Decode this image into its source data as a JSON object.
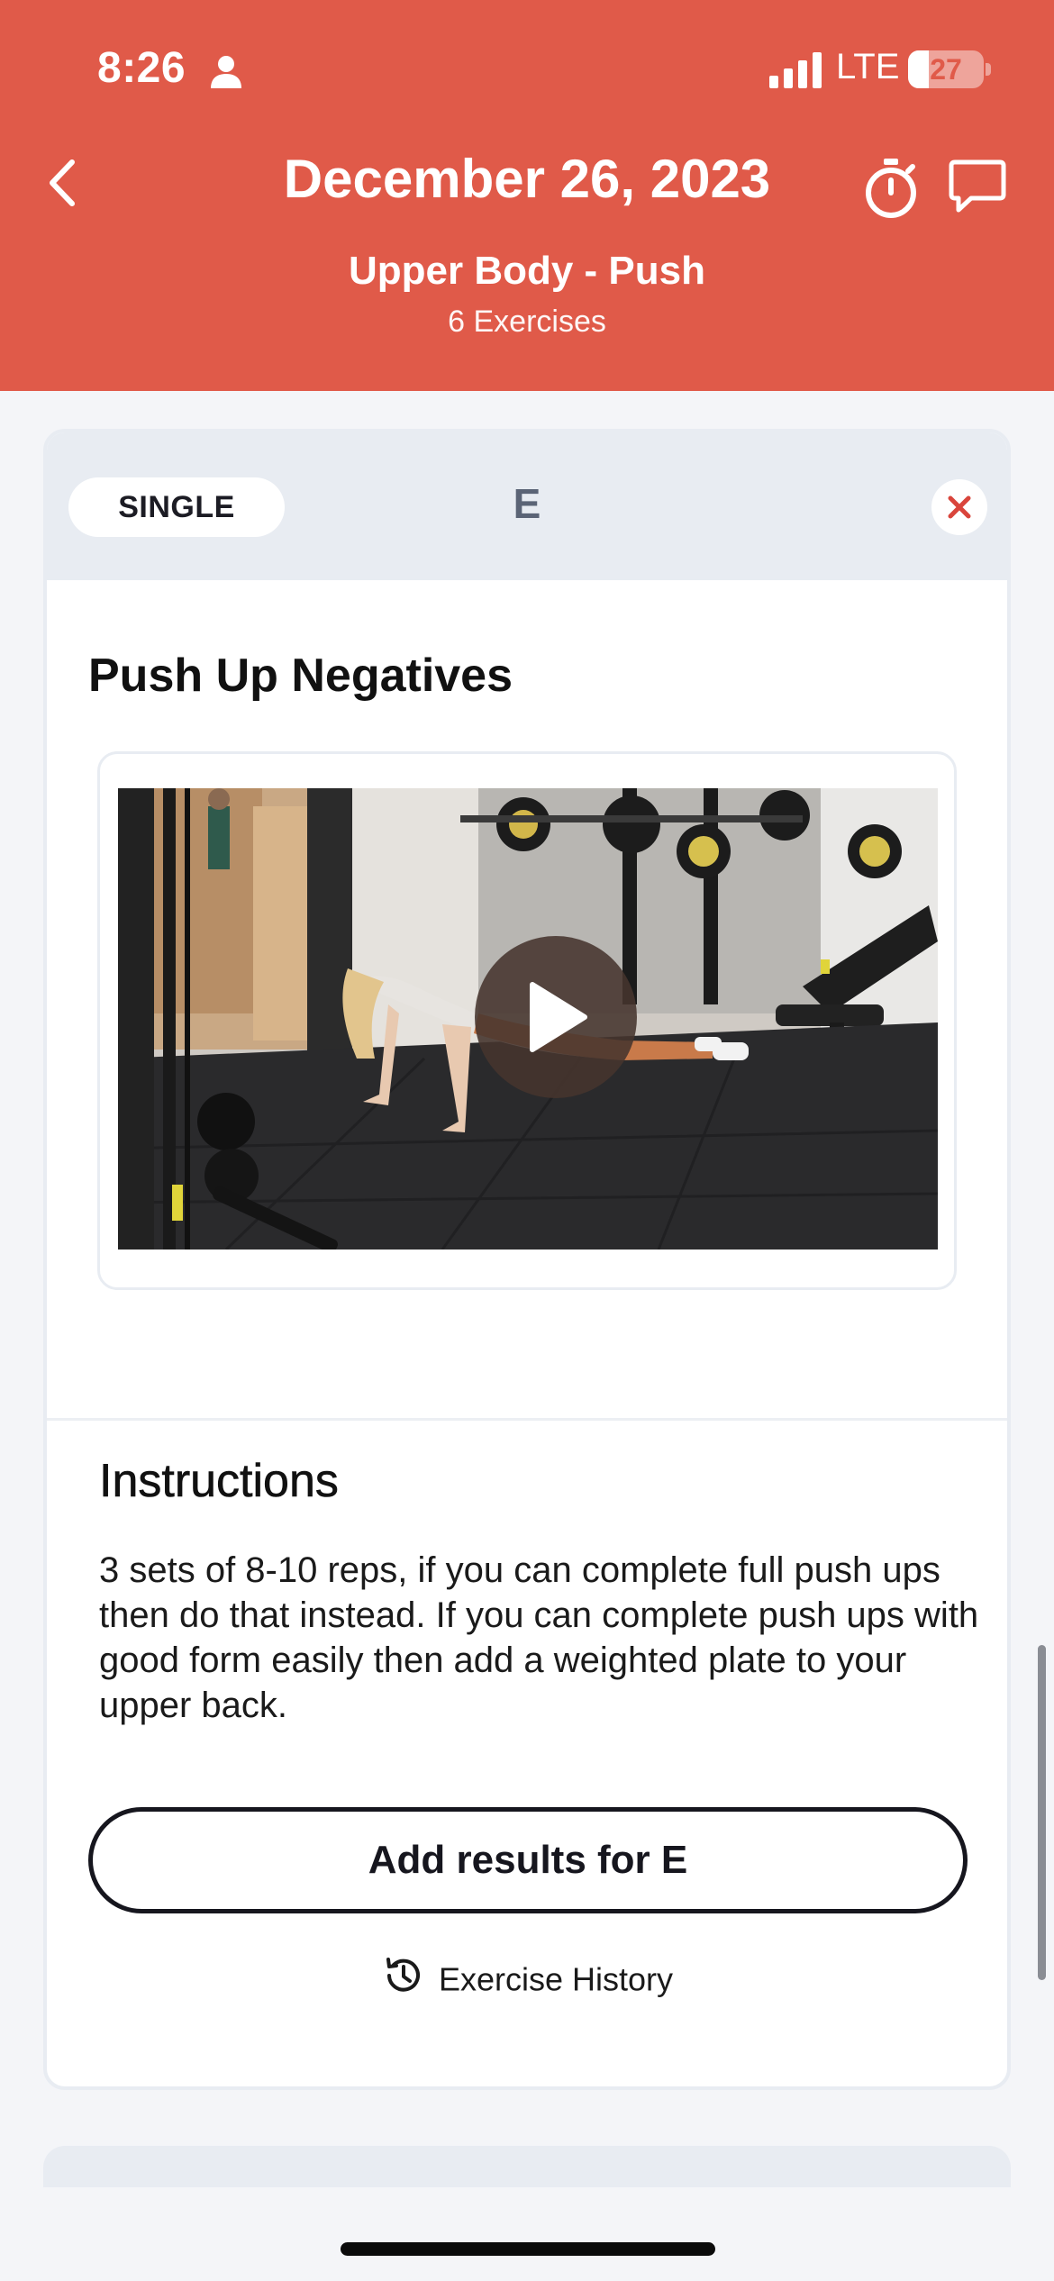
{
  "status_bar": {
    "time": "8:26",
    "carrier": "LTE",
    "battery_level": "27",
    "battery_fraction": 0.27
  },
  "header": {
    "date": "December 26, 2023",
    "workout_name": "Upper Body - Push",
    "exercise_count": "6 Exercises",
    "icons": [
      "chevron-left-icon",
      "stopwatch-icon",
      "chat-bubble-icon"
    ]
  },
  "exercise_card": {
    "type_label": "SINGLE",
    "letter": "E",
    "name": "Push Up Negatives",
    "video": {
      "icon": "play-icon"
    },
    "instructions_title": "Instructions",
    "instructions_text": "3 sets of 8-10 reps, if you can complete full push ups then do that instead. If you can complete push ups with good form easily then add a weighted plate to your upper back.",
    "add_results_label": "Add results for E",
    "history_label": "Exercise History"
  },
  "colors": {
    "header": "#e05a49",
    "remove_icon": "#d9453c",
    "card_top": "#e8ecf2",
    "letter": "#5b6476",
    "button_border": "#16161e"
  }
}
